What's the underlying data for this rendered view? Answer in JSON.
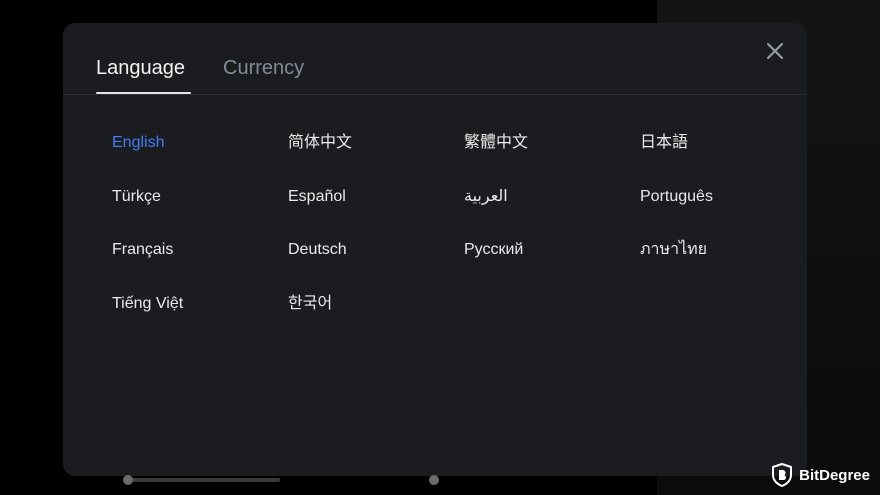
{
  "tabs": {
    "language": "Language",
    "currency": "Currency"
  },
  "active_tab": "language",
  "languages": [
    {
      "label": "English",
      "active": true
    },
    {
      "label": "简体中文",
      "active": false
    },
    {
      "label": "繁體中文",
      "active": false
    },
    {
      "label": "日本語",
      "active": false
    },
    {
      "label": "Türkçe",
      "active": false
    },
    {
      "label": "Español",
      "active": false
    },
    {
      "label": "العربية",
      "active": false
    },
    {
      "label": "Português",
      "active": false
    },
    {
      "label": "Français",
      "active": false
    },
    {
      "label": "Deutsch",
      "active": false
    },
    {
      "label": "Русский",
      "active": false
    },
    {
      "label": "ภาษาไทย",
      "active": false
    },
    {
      "label": "Tiếng Việt",
      "active": false
    },
    {
      "label": "한국어",
      "active": false
    }
  ],
  "colors": {
    "accent": "#3f7ef6",
    "modal_bg": "#1a1c20",
    "text": "#eaeaea",
    "muted": "#848b98"
  },
  "icons": {
    "close": "close-icon"
  },
  "watermark": {
    "text": "BitDegree"
  }
}
